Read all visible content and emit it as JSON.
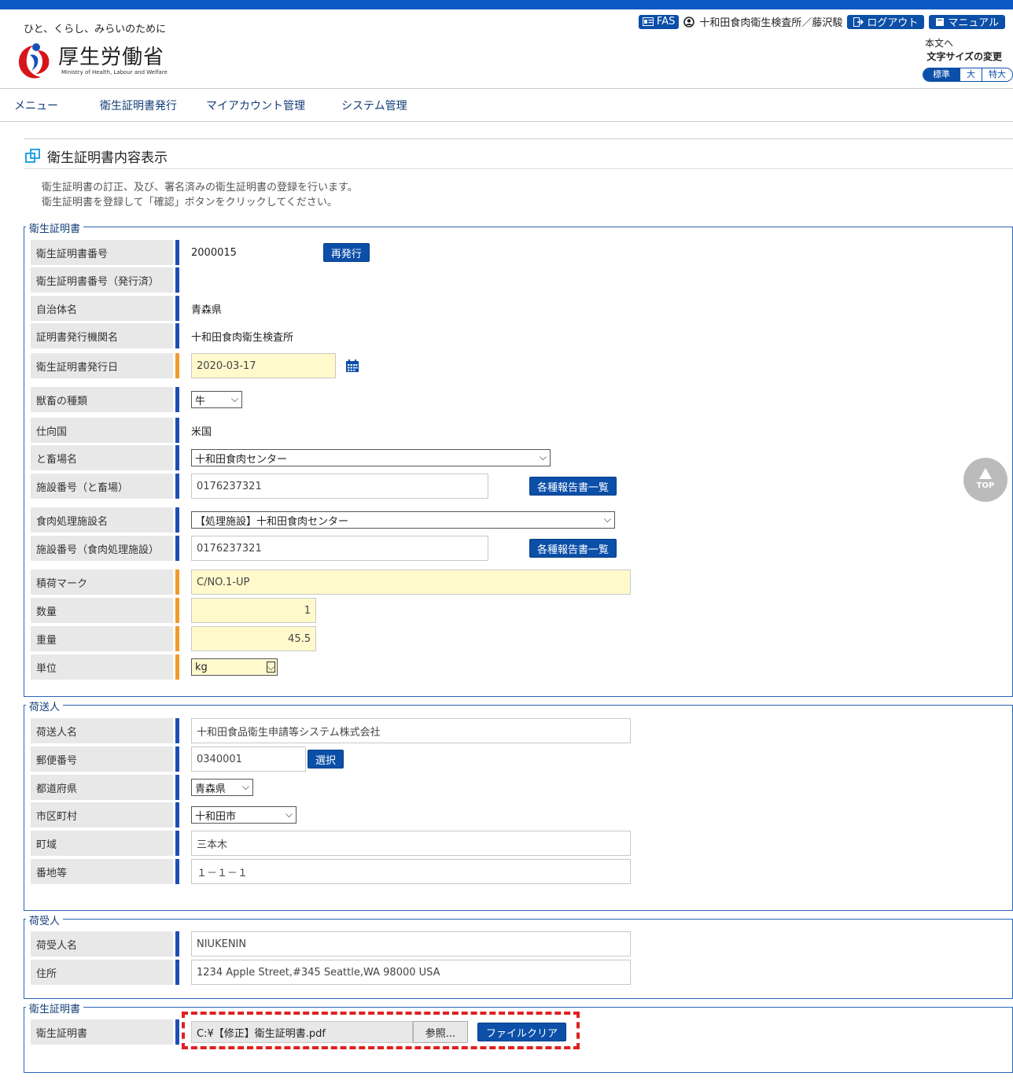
{
  "header": {
    "tagline": "ひと、くらし、みらいのために",
    "logo_text": "厚生労働省",
    "logo_sub": "Ministry of Health, Labour and Welfare",
    "fas_label": "FAS",
    "user": "十和田食肉衛生検査所／藤沢駿",
    "logout_label": "ログアウト",
    "manual_label": "マニュアル",
    "skip_link": "本文へ",
    "font_size_label": "文字サイズの変更",
    "font_sizes": [
      "標準",
      "大",
      "特大"
    ]
  },
  "nav": [
    "メニュー",
    "衛生証明書発行",
    "マイアカウント管理",
    "システム管理"
  ],
  "page": {
    "title": "衛生証明書内容表示",
    "desc1": "衛生証明書の訂正、及び、署名済みの衛生証明書の登録を行います。",
    "desc2": "衛生証明書を登録して「確認」ボタンをクリックしてください。"
  },
  "certificate": {
    "legend": "衛生証明書",
    "fields": {
      "number_label": "衛生証明書番号",
      "number_value": "2000015",
      "reissue_btn": "再発行",
      "issued_number_label": "衛生証明書番号（発行済）",
      "municipality_label": "自治体名",
      "municipality_value": "青森県",
      "issuer_label": "証明書発行機関名",
      "issuer_value": "十和田食肉衛生検査所",
      "issue_date_label": "衛生証明書発行日",
      "issue_date_value": "2020-03-17",
      "animal_label": "獣畜の種類",
      "animal_value": "牛",
      "destination_label": "仕向国",
      "destination_value": "米国",
      "slaughterhouse_label": "と畜場名",
      "slaughterhouse_value": "十和田食肉センター",
      "slaughter_no_label": "施設番号（と畜場）",
      "slaughter_no_value": "0176237321",
      "reports_btn": "各種報告書一覧",
      "processing_label": "食肉処理施設名",
      "processing_value": "【処理施設】十和田食肉センター",
      "processing_no_label": "施設番号（食肉処理施設）",
      "processing_no_value": "0176237321",
      "mark_label": "積荷マーク",
      "mark_value": "C/NO.1-UP",
      "quantity_label": "数量",
      "quantity_value": "1",
      "weight_label": "重量",
      "weight_value": "45.5",
      "unit_label": "単位",
      "unit_value": "kg"
    }
  },
  "shipper": {
    "legend": "荷送人",
    "name_label": "荷送人名",
    "name_value": "十和田食品衛生申請等システム株式会社",
    "zip_label": "郵便番号",
    "zip_value": "0340001",
    "select_btn": "選択",
    "pref_label": "都道府県",
    "pref_value": "青森県",
    "city_label": "市区町村",
    "city_value": "十和田市",
    "town_label": "町域",
    "town_value": "三本木",
    "addr_label": "番地等",
    "addr_value": "１－１－１"
  },
  "consignee": {
    "legend": "荷受人",
    "name_label": "荷受人名",
    "name_value": "NIUKENIN",
    "addr_label": "住所",
    "addr_value": "1234 Apple Street,#345 Seattle,WA 98000 USA"
  },
  "upload": {
    "legend": "衛生証明書",
    "label": "衛生証明書",
    "file_value": "C:¥【修正】衛生証明書.pdf",
    "browse_btn": "参照...",
    "clear_btn": "ファイルクリア"
  },
  "top_button": "TOP",
  "colors": {
    "brand": "#0b4fa8",
    "required_bar": "#f39a2c",
    "normal_bar": "#1d4fb5",
    "highlight": "#e02020"
  }
}
